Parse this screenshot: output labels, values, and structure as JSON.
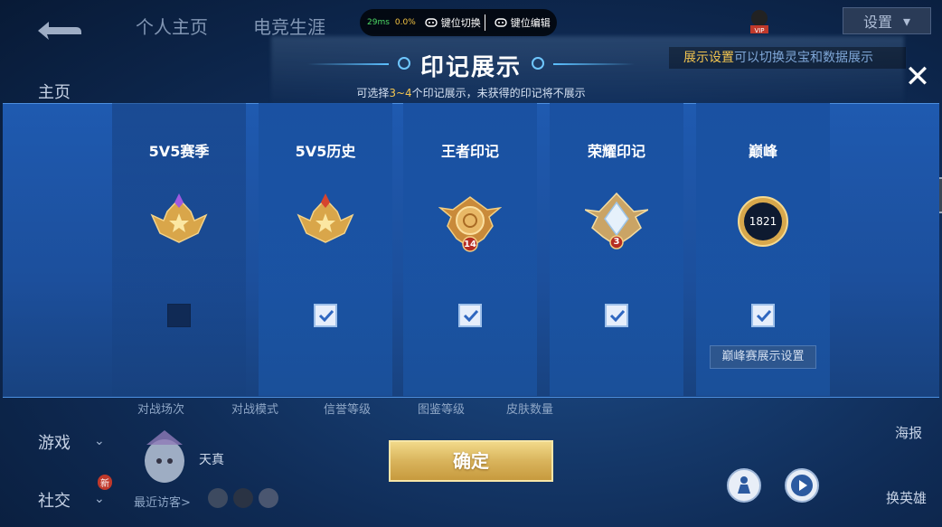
{
  "top_nav": {
    "tabs": [
      "个人主页",
      "电竞生涯"
    ]
  },
  "left_nav": {
    "items": [
      "主页",
      "游戏",
      "社交"
    ],
    "badge": "新"
  },
  "toolbar": {
    "ping": "29ms",
    "loss": "0.0%",
    "switch_label": "键位切换",
    "edit_label": "键位编辑"
  },
  "settings": {
    "label": "设置",
    "hint_prefix": "展示设置",
    "hint_suffix": "可以切换灵宝和数据展示"
  },
  "dialog": {
    "title": "印记展示",
    "subtitle_prefix": "可选择",
    "subtitle_range": "3~4",
    "subtitle_suffix": "个印记展示，未获得的印记将不展示",
    "close_icon": "close-icon",
    "confirm_label": "确定"
  },
  "cards": [
    {
      "title": "5V5赛季",
      "checked": false,
      "icon": "season-badge-icon"
    },
    {
      "title": "5V5历史",
      "checked": true,
      "icon": "history-badge-icon"
    },
    {
      "title": "王者印记",
      "checked": true,
      "icon": "king-mark-icon",
      "level": "14"
    },
    {
      "title": "荣耀印记",
      "checked": true,
      "icon": "glory-mark-icon",
      "level": "3"
    },
    {
      "title": "巅峰",
      "checked": true,
      "icon": "peak-badge-icon",
      "score": "1821",
      "extra_button": "巅峰赛展示设置"
    }
  ],
  "background": {
    "stats": [
      "对战场次",
      "对战模式",
      "信誉等级",
      "图鉴等级",
      "皮肤数量"
    ],
    "nickname": "天真",
    "visitors_label": "最近访客>",
    "right_labels": [
      "海报",
      "换英雄"
    ]
  },
  "colors": {
    "accent_gold": "#f3c550",
    "panel_blue": "#1f5ab0",
    "confirm_gold": "#d9b45c"
  }
}
